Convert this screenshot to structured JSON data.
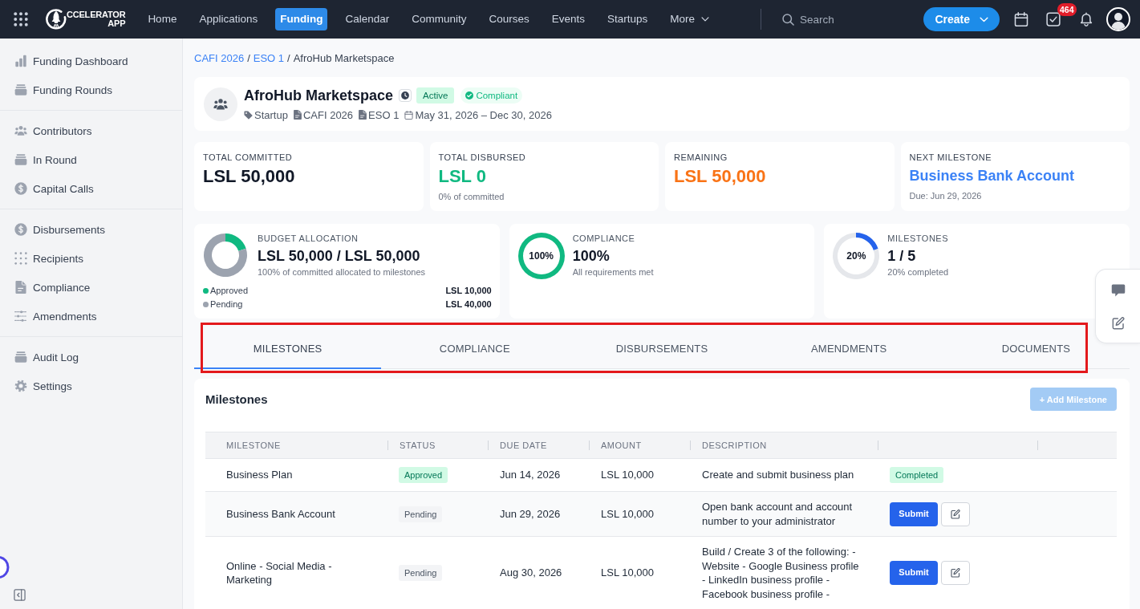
{
  "topbar": {
    "logo": {
      "lines": [
        "CCELERATOR",
        "APP"
      ]
    },
    "nav": [
      {
        "label": "Home",
        "kind": "link",
        "selected": false
      },
      {
        "label": "Applications",
        "kind": "link",
        "selected": false
      },
      {
        "label": "Funding",
        "kind": "link",
        "selected": true
      },
      {
        "label": "Calendar",
        "kind": "link",
        "selected": false
      },
      {
        "label": "Community",
        "kind": "link",
        "selected": false
      },
      {
        "label": "Courses",
        "kind": "link",
        "selected": false
      },
      {
        "label": "Events",
        "kind": "link",
        "selected": false
      },
      {
        "label": "Startups",
        "kind": "link",
        "selected": false
      },
      {
        "label": "More",
        "kind": "dropdown",
        "selected": false
      }
    ],
    "search": {
      "placeholder": "Search"
    },
    "create_button": {
      "label": "Create"
    },
    "tasks_badge": "464"
  },
  "sidebar": {
    "groups": [
      {
        "items": [
          {
            "label": "Funding Dashboard",
            "selected": false
          },
          {
            "label": "Funding Rounds",
            "selected": false
          }
        ]
      },
      {
        "items": [
          {
            "label": "Contributors",
            "selected": false
          },
          {
            "label": "In Round",
            "selected": false
          },
          {
            "label": "Capital Calls",
            "selected": false
          }
        ]
      },
      {
        "items": [
          {
            "label": "Disbursements",
            "selected": false
          },
          {
            "label": "Recipients",
            "selected": false
          },
          {
            "label": "Compliance",
            "selected": false
          },
          {
            "label": "Amendments",
            "selected": false
          }
        ]
      },
      {
        "items": [
          {
            "label": "Audit Log",
            "selected": false
          },
          {
            "label": "Settings",
            "selected": false
          }
        ]
      }
    ]
  },
  "breadcrumb": [
    {
      "kind": "link",
      "text": "CAFI 2026"
    },
    {
      "kind": "separator",
      "text": "/"
    },
    {
      "kind": "link",
      "text": "ESO 1"
    },
    {
      "kind": "separator",
      "text": "/"
    },
    {
      "kind": "current",
      "text": "AfroHub Marketspace"
    }
  ],
  "header": {
    "title": "AfroHub Marketspace",
    "badges": [
      {
        "kind": "status",
        "label": "Active"
      },
      {
        "kind": "check",
        "label": "Compliant"
      }
    ],
    "meta": [
      "Startup",
      "CAFI 2026",
      "ESO 1",
      "May 31, 2026 – Dec 30, 2026"
    ]
  },
  "stats": [
    {
      "label": "TOTAL COMMITTED",
      "value": "LSL 50,000",
      "kind": "neutral"
    },
    {
      "label": "TOTAL DISBURSED",
      "value": "LSL 0",
      "note": "0% of committed",
      "kind": "success"
    },
    {
      "label": "REMAINING",
      "value": "LSL 50,000",
      "kind": "warning"
    },
    {
      "label": "NEXT MILESTONE",
      "value": "Business Bank Account",
      "note": "Due: Jun 29, 2026",
      "kind": "link"
    }
  ],
  "summary": [
    {
      "kind": "budget",
      "label": "BUDGET ALLOCATION",
      "value": "LSL 50,000 / LSL 50,000",
      "note": "100% of committed allocated to milestones",
      "chart_data": {
        "type": "donut",
        "categories": [
          "Approved",
          "Pending"
        ],
        "values": [
          20,
          80
        ]
      },
      "legend": [
        {
          "amount": "LSL 10,000",
          "color": "#10b981"
        },
        {
          "amount": "LSL 40,000",
          "color": "#9ca3af"
        }
      ]
    },
    {
      "kind": "ring",
      "label": "COMPLIANCE",
      "value": "100%",
      "note": "All requirements met",
      "reading": "100%",
      "color": "#10b981",
      "ring": {
        "level": 1
      }
    },
    {
      "kind": "ring",
      "label": "MILESTONES",
      "value": "1 / 5",
      "note": "20% completed",
      "reading": "20%",
      "color": "#2563eb",
      "chart_data": {
        "type": "donut",
        "values": [
          20,
          80
        ]
      }
    }
  ],
  "tabs": {
    "highlighted": true,
    "items": [
      {
        "label": "MILESTONES",
        "selected": true
      },
      {
        "label": "COMPLIANCE",
        "selected": false
      },
      {
        "label": "DISBURSEMENTS",
        "selected": false
      },
      {
        "label": "AMENDMENTS",
        "selected": false
      },
      {
        "label": "DOCUMENTS",
        "selected": false
      }
    ]
  },
  "milestones": {
    "title": "Milestones",
    "add_button": {
      "label": "+ Add Milestone",
      "disabled": true
    },
    "table": {
      "columns": [
        "MILESTONE",
        "STATUS",
        "DUE DATE",
        "AMOUNT",
        "DESCRIPTION"
      ],
      "rows": [
        {
          "milestone": "Business Plan",
          "status": {
            "label": "Approved",
            "kind": "approved"
          },
          "due_date": "Jun 14, 2026",
          "amount": "LSL 10,000",
          "description": "Create and submit business plan",
          "action": {
            "kind": "badge",
            "label": "Completed"
          }
        },
        {
          "milestone": "Business Bank Account",
          "status": {
            "label": "Pending",
            "kind": "pending"
          },
          "due_date": "Jun 29, 2026",
          "amount": "LSL 10,000",
          "description": "Open bank account and account number to your administrator",
          "action": {
            "kind": "submit",
            "label": "Submit"
          }
        },
        {
          "milestone": "Online - Social Media - Marketing",
          "status": {
            "label": "Pending",
            "kind": "pending"
          },
          "due_date": "Aug 30, 2026",
          "amount": "LSL 10,000",
          "description": "Build / Create 3 of the following: - Website - Google Business profile - LinkedIn business profile - Facebook business profile -",
          "action": {
            "kind": "submit",
            "label": "Submit"
          }
        }
      ]
    }
  }
}
